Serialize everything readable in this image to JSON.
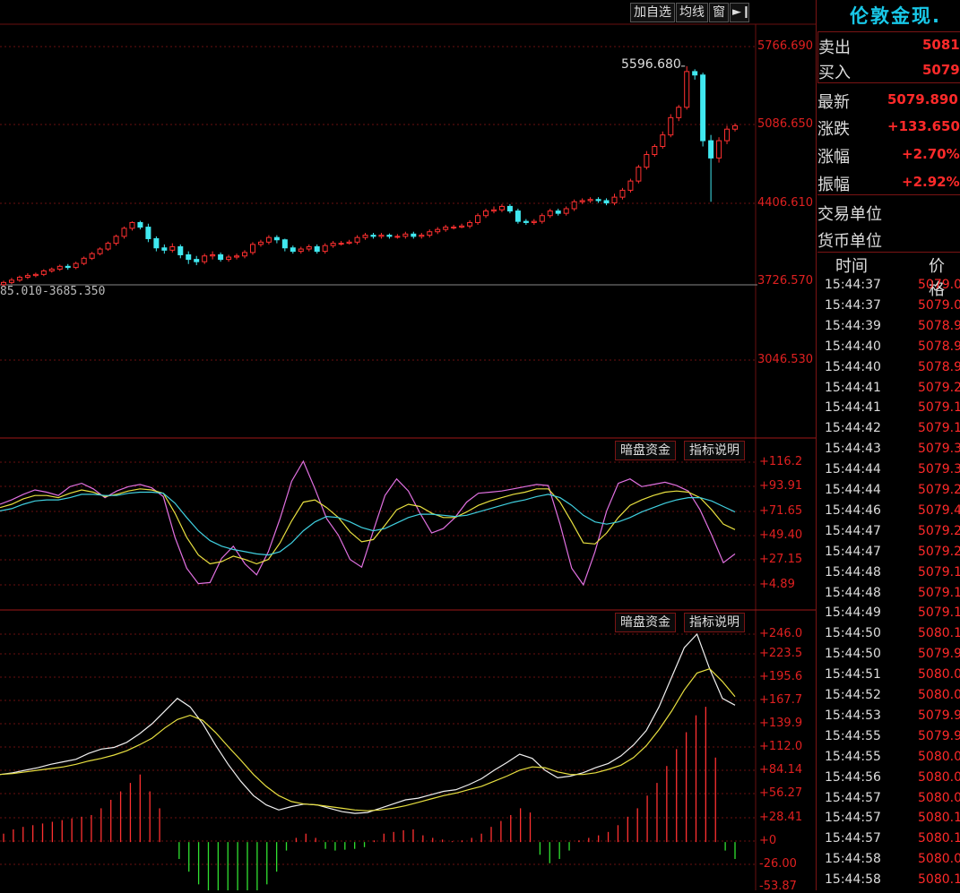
{
  "toolbar": {
    "add_watch": "加自选",
    "ma_line": "均线",
    "window": "窗",
    "panel_toggle_icon": "arrow-right-icon"
  },
  "main_chart": {
    "high_marker": "5596.680",
    "range_label": "85.010-3685.350",
    "y_ticks": [
      "5766.690",
      "5086.650",
      "4406.610",
      "3726.570",
      "3046.530"
    ]
  },
  "indicator1": {
    "btn_fund": "暗盘资金",
    "btn_explain": "指标说明",
    "y_ticks": [
      "+116.2",
      "+93.91",
      "+71.65",
      "+49.40",
      "+27.15",
      "+4.89"
    ]
  },
  "indicator2": {
    "btn_fund": "暗盘资金",
    "btn_explain": "指标说明",
    "y_ticks": [
      "+246.0",
      "+223.5",
      "+195.6",
      "+167.7",
      "+139.9",
      "+112.0",
      "+84.14",
      "+56.27",
      "+28.41",
      "+0",
      "-26.00",
      "-53.87"
    ]
  },
  "quote": {
    "title": "伦敦金现",
    "title_tail": ".",
    "sell_label": "卖出",
    "sell_value": "5081.",
    "buy_label": "买入",
    "buy_value": "5079.",
    "last_label": "最新",
    "last_value": "5079.890",
    "change_label": "涨跌",
    "change_value": "+133.650",
    "pct_label": "涨幅",
    "pct_value": "+2.70%",
    "amp_label": "振幅",
    "amp_value": "+2.92%",
    "unit_label": "交易单位",
    "currency_label": "货币单位",
    "ticks_header_time": "时间",
    "ticks_header_price": "价格"
  },
  "ticks": [
    {
      "time": "15:44:37",
      "price": "5079.0"
    },
    {
      "time": "15:44:37",
      "price": "5079.0"
    },
    {
      "time": "15:44:39",
      "price": "5078.9"
    },
    {
      "time": "15:44:40",
      "price": "5078.9"
    },
    {
      "time": "15:44:40",
      "price": "5078.9"
    },
    {
      "time": "15:44:41",
      "price": "5079.2"
    },
    {
      "time": "15:44:41",
      "price": "5079.1"
    },
    {
      "time": "15:44:42",
      "price": "5079.1"
    },
    {
      "time": "15:44:43",
      "price": "5079.3"
    },
    {
      "time": "15:44:44",
      "price": "5079.3"
    },
    {
      "time": "15:44:44",
      "price": "5079.2"
    },
    {
      "time": "15:44:46",
      "price": "5079.4"
    },
    {
      "time": "15:44:47",
      "price": "5079.2"
    },
    {
      "time": "15:44:47",
      "price": "5079.2"
    },
    {
      "time": "15:44:48",
      "price": "5079.1"
    },
    {
      "time": "15:44:48",
      "price": "5079.1"
    },
    {
      "time": "15:44:49",
      "price": "5079.1"
    },
    {
      "time": "15:44:50",
      "price": "5080.1"
    },
    {
      "time": "15:44:50",
      "price": "5079.9"
    },
    {
      "time": "15:44:51",
      "price": "5080.0"
    },
    {
      "time": "15:44:52",
      "price": "5080.0"
    },
    {
      "time": "15:44:53",
      "price": "5079.9"
    },
    {
      "time": "15:44:55",
      "price": "5079.9"
    },
    {
      "time": "15:44:55",
      "price": "5080.0"
    },
    {
      "time": "15:44:56",
      "price": "5080.0"
    },
    {
      "time": "15:44:57",
      "price": "5080.0"
    },
    {
      "time": "15:44:57",
      "price": "5080.1"
    },
    {
      "time": "15:44:57",
      "price": "5080.1"
    },
    {
      "time": "15:44:58",
      "price": "5080.0"
    },
    {
      "time": "15:44:58",
      "price": "5080.1"
    }
  ],
  "colors": {
    "up": "#ff3030",
    "down": "#40e8f0",
    "grid": "#6a1010",
    "k_line": "#e070e0",
    "d_line": "#e8e040",
    "j_line": "#40d0e0",
    "fast_line": "#f0f0f0",
    "slow_line": "#e8e040",
    "hist_pos": "#ff3030",
    "hist_neg": "#30e030"
  },
  "chart_data": [
    {
      "type": "candlestick",
      "ylim": [
        3046.53,
        5766.69
      ],
      "high_label_value": 5596.68,
      "candles": [
        [
          3700,
          3720,
          3680,
          3735
        ],
        [
          3720,
          3740,
          3705,
          3760
        ],
        [
          3740,
          3765,
          3725,
          3780
        ],
        [
          3765,
          3780,
          3750,
          3800
        ],
        [
          3780,
          3790,
          3765,
          3805
        ],
        [
          3790,
          3820,
          3775,
          3835
        ],
        [
          3820,
          3835,
          3805,
          3850
        ],
        [
          3835,
          3860,
          3820,
          3875
        ],
        [
          3860,
          3850,
          3830,
          3880
        ],
        [
          3850,
          3885,
          3835,
          3900
        ],
        [
          3885,
          3930,
          3870,
          3945
        ],
        [
          3930,
          3970,
          3915,
          3985
        ],
        [
          3970,
          4010,
          3955,
          4025
        ],
        [
          4010,
          4060,
          3995,
          4075
        ],
        [
          4060,
          4120,
          4040,
          4135
        ],
        [
          4120,
          4190,
          4100,
          4205
        ],
        [
          4190,
          4240,
          4170,
          4250
        ],
        [
          4240,
          4200,
          4180,
          4255
        ],
        [
          4200,
          4100,
          4070,
          4230
        ],
        [
          4100,
          4020,
          3990,
          4120
        ],
        [
          4020,
          4000,
          3970,
          4050
        ],
        [
          4000,
          4030,
          3980,
          4060
        ],
        [
          4030,
          3960,
          3930,
          4050
        ],
        [
          3960,
          3920,
          3880,
          3990
        ],
        [
          3920,
          3900,
          3870,
          3950
        ],
        [
          3900,
          3950,
          3880,
          3970
        ],
        [
          3950,
          3960,
          3920,
          3990
        ],
        [
          3960,
          3920,
          3900,
          3980
        ],
        [
          3920,
          3940,
          3900,
          3960
        ],
        [
          3940,
          3950,
          3920,
          3970
        ],
        [
          3950,
          3980,
          3930,
          4000
        ],
        [
          3980,
          4050,
          3960,
          4070
        ],
        [
          4050,
          4070,
          4030,
          4090
        ],
        [
          4070,
          4110,
          4050,
          4130
        ],
        [
          4110,
          4090,
          4060,
          4130
        ],
        [
          4090,
          4020,
          3990,
          4100
        ],
        [
          4020,
          3990,
          3970,
          4040
        ],
        [
          3990,
          4010,
          3970,
          4030
        ],
        [
          4010,
          4030,
          3990,
          4050
        ],
        [
          4030,
          3990,
          3970,
          4050
        ],
        [
          3990,
          4040,
          3970,
          4060
        ],
        [
          4040,
          4060,
          4020,
          4080
        ],
        [
          4060,
          4060,
          4040,
          4080
        ],
        [
          4060,
          4070,
          4050,
          4090
        ],
        [
          4070,
          4110,
          4050,
          4130
        ],
        [
          4110,
          4130,
          4090,
          4150
        ],
        [
          4130,
          4120,
          4100,
          4150
        ],
        [
          4120,
          4130,
          4100,
          4150
        ],
        [
          4130,
          4120,
          4100,
          4145
        ],
        [
          4120,
          4120,
          4100,
          4140
        ],
        [
          4120,
          4140,
          4100,
          4160
        ],
        [
          4140,
          4120,
          4100,
          4160
        ],
        [
          4120,
          4130,
          4100,
          4150
        ],
        [
          4130,
          4160,
          4110,
          4180
        ],
        [
          4160,
          4180,
          4140,
          4200
        ],
        [
          4180,
          4200,
          4160,
          4220
        ],
        [
          4200,
          4200,
          4180,
          4220
        ],
        [
          4200,
          4210,
          4190,
          4230
        ],
        [
          4210,
          4240,
          4190,
          4260
        ],
        [
          4240,
          4300,
          4220,
          4320
        ],
        [
          4300,
          4340,
          4280,
          4360
        ],
        [
          4340,
          4350,
          4320,
          4380
        ],
        [
          4350,
          4380,
          4330,
          4400
        ],
        [
          4380,
          4340,
          4320,
          4400
        ],
        [
          4340,
          4250,
          4230,
          4360
        ],
        [
          4250,
          4240,
          4220,
          4270
        ],
        [
          4240,
          4250,
          4220,
          4270
        ],
        [
          4250,
          4300,
          4230,
          4320
        ],
        [
          4300,
          4340,
          4280,
          4360
        ],
        [
          4340,
          4320,
          4300,
          4360
        ],
        [
          4320,
          4360,
          4300,
          4380
        ],
        [
          4360,
          4420,
          4340,
          4440
        ],
        [
          4420,
          4430,
          4400,
          4450
        ],
        [
          4430,
          4440,
          4410,
          4460
        ],
        [
          4440,
          4430,
          4410,
          4460
        ],
        [
          4430,
          4410,
          4390,
          4450
        ],
        [
          4410,
          4460,
          4390,
          4490
        ],
        [
          4460,
          4520,
          4440,
          4540
        ],
        [
          4520,
          4600,
          4500,
          4620
        ],
        [
          4600,
          4720,
          4580,
          4740
        ],
        [
          4720,
          4830,
          4700,
          4860
        ],
        [
          4830,
          4900,
          4810,
          4920
        ],
        [
          4900,
          5000,
          4880,
          5030
        ],
        [
          5000,
          5150,
          4980,
          5180
        ],
        [
          5150,
          5240,
          5120,
          5260
        ],
        [
          5240,
          5550,
          5220,
          5596.68
        ],
        [
          5550,
          5520,
          5480,
          5570
        ],
        [
          5520,
          4950,
          4900,
          5540
        ],
        [
          4950,
          4800,
          4420,
          5000
        ],
        [
          4800,
          4950,
          4760,
          4980
        ],
        [
          4950,
          5050,
          4920,
          5080
        ],
        [
          5050,
          5079.89,
          5030,
          5100
        ]
      ]
    },
    {
      "type": "line",
      "ylim": [
        4.89,
        116.2
      ],
      "series": [
        {
          "values": [
            78,
            82,
            87,
            91,
            89,
            86,
            94,
            97,
            92,
            84,
            90,
            94,
            96,
            93,
            85,
            48,
            20,
            6,
            7,
            29,
            40,
            24,
            14,
            35,
            65,
            99,
            117,
            92,
            65,
            50,
            28,
            21,
            54,
            86,
            101,
            90,
            70,
            52,
            56,
            66,
            80,
            88,
            89,
            90,
            92,
            94,
            96,
            95,
            60,
            20,
            5,
            35,
            72,
            97,
            101,
            94,
            96,
            98,
            95,
            90,
            73,
            50,
            25,
            33
          ]
        },
        {
          "values": [
            75,
            78,
            83,
            86,
            86,
            84,
            88,
            91,
            89,
            85,
            87,
            90,
            92,
            91,
            88,
            70,
            48,
            32,
            24,
            26,
            31,
            28,
            24,
            28,
            43,
            63,
            80,
            82,
            75,
            66,
            53,
            44,
            46,
            59,
            73,
            78,
            76,
            70,
            66,
            66,
            71,
            77,
            81,
            84,
            87,
            89,
            92,
            92,
            80,
            62,
            43,
            42,
            52,
            66,
            77,
            82,
            86,
            89,
            90,
            89,
            84,
            73,
            60,
            55
          ]
        },
        {
          "values": [
            72,
            74,
            78,
            81,
            82,
            82,
            84,
            87,
            87,
            86,
            86,
            88,
            89,
            89,
            88,
            79,
            66,
            54,
            45,
            40,
            37,
            35,
            33,
            32,
            35,
            43,
            54,
            62,
            67,
            66,
            62,
            57,
            54,
            56,
            61,
            66,
            69,
            69,
            68,
            67,
            68,
            71,
            74,
            77,
            80,
            82,
            85,
            87,
            84,
            77,
            68,
            62,
            60,
            62,
            66,
            71,
            75,
            79,
            82,
            84,
            84,
            81,
            76,
            71
          ]
        }
      ]
    },
    {
      "type": "bar+line",
      "ylim": [
        -53.87,
        246.0
      ],
      "histogram": [
        10,
        15,
        18,
        20,
        22,
        24,
        26,
        28,
        30,
        32,
        40,
        50,
        60,
        70,
        80,
        60,
        40,
        0,
        -20,
        -35,
        -50,
        -60,
        -65,
        -70,
        -68,
        -65,
        -60,
        -50,
        -35,
        -10,
        5,
        10,
        5,
        -8,
        -10,
        -9,
        -8,
        -6,
        2,
        10,
        12,
        14,
        15,
        8,
        5,
        3,
        1,
        2,
        5,
        10,
        18,
        25,
        32,
        40,
        35,
        -15,
        -25,
        -20,
        -10,
        2,
        5,
        8,
        12,
        20,
        30,
        40,
        55,
        70,
        90,
        110,
        130,
        150,
        160,
        100,
        -10,
        -20
      ],
      "series": [
        {
          "values": [
            80,
            82,
            85,
            88,
            92,
            95,
            98,
            105,
            110,
            112,
            118,
            128,
            140,
            155,
            170,
            160,
            140,
            115,
            92,
            72,
            55,
            44,
            38,
            42,
            45,
            44,
            40,
            36,
            34,
            35,
            40,
            45,
            50,
            52,
            56,
            60,
            62,
            68,
            75,
            85,
            94,
            104,
            99,
            85,
            76,
            78,
            82,
            88,
            93,
            102,
            115,
            132,
            160,
            195,
            230,
            246,
            205,
            170,
            162
          ]
        },
        {
          "values": [
            80,
            81,
            83,
            85,
            87,
            89,
            92,
            96,
            99,
            103,
            108,
            115,
            123,
            135,
            145,
            150,
            144,
            130,
            113,
            97,
            80,
            66,
            55,
            48,
            45,
            44,
            42,
            40,
            38,
            37,
            38,
            40,
            43,
            47,
            51,
            55,
            58,
            62,
            66,
            72,
            78,
            85,
            89,
            88,
            83,
            80,
            80,
            82,
            86,
            91,
            100,
            114,
            133,
            155,
            180,
            200,
            205,
            190,
            172
          ]
        }
      ]
    }
  ]
}
